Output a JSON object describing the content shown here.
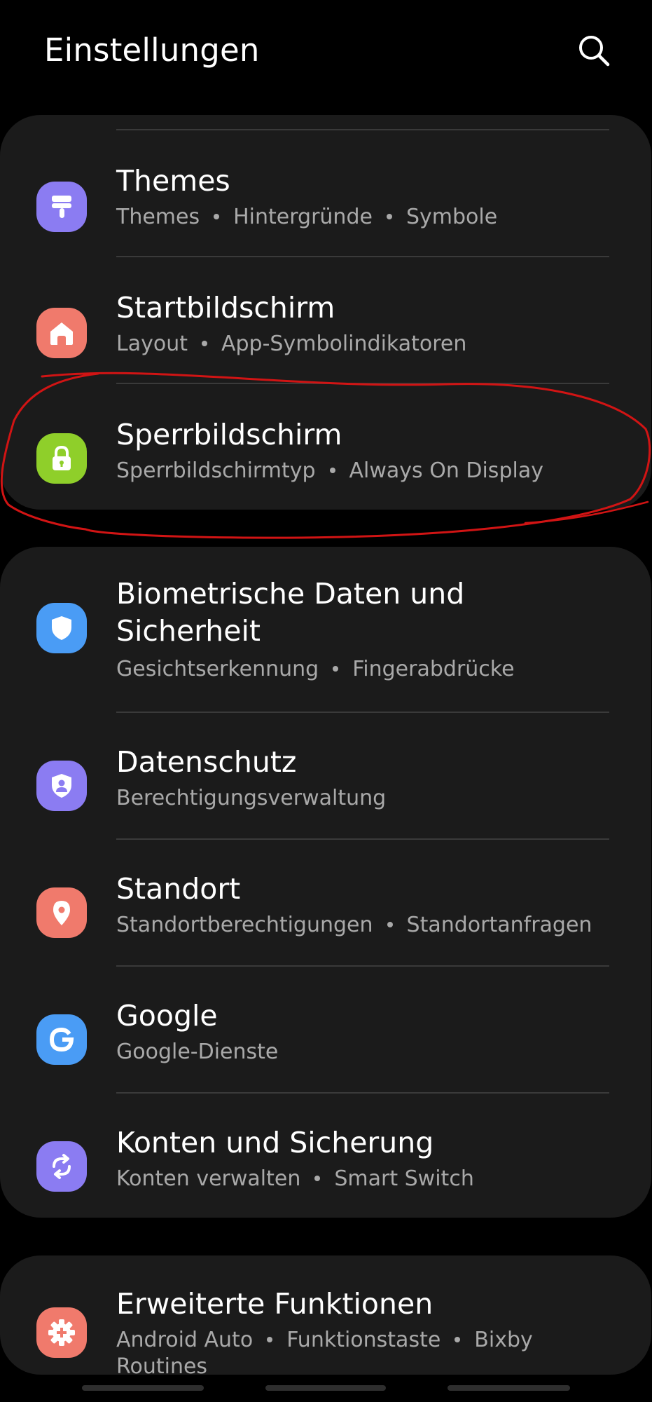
{
  "header": {
    "title": "Einstellungen",
    "search_icon": "search-icon"
  },
  "cards": [
    {
      "items": [
        {
          "title": "Themes",
          "subtitle": [
            "Themes",
            "Hintergründe",
            "Symbole"
          ],
          "icon": "paintbrush-icon",
          "icon_color": "#8b7cf2"
        },
        {
          "title": "Startbildschirm",
          "subtitle": [
            "Layout",
            "App-Symbolindikatoren"
          ],
          "icon": "home-icon",
          "icon_color": "#f07a6c"
        },
        {
          "title": "Sperrbildschirm",
          "subtitle": [
            "Sperrbildschirmtyp",
            "Always On Display"
          ],
          "icon": "lock-icon",
          "icon_color": "#8fcf2a"
        }
      ]
    },
    {
      "items": [
        {
          "title": "Biometrische Daten und Sicherheit",
          "subtitle": [
            "Gesichtserkennung",
            "Fingerabdrücke"
          ],
          "icon": "shield-icon",
          "icon_color": "#4a9cf5"
        },
        {
          "title": "Datenschutz",
          "subtitle": [
            "Berechtigungsverwaltung"
          ],
          "icon": "privacy-shield-icon",
          "icon_color": "#8b7cf2"
        },
        {
          "title": "Standort",
          "subtitle": [
            "Standortberechtigungen",
            "Standortanfragen"
          ],
          "icon": "location-pin-icon",
          "icon_color": "#f07a6c"
        },
        {
          "title": "Google",
          "subtitle": [
            "Google-Dienste"
          ],
          "icon": "google-icon",
          "icon_color": "#4a9cf5"
        },
        {
          "title": "Konten und Sicherung",
          "subtitle": [
            "Konten verwalten",
            "Smart Switch"
          ],
          "icon": "sync-icon",
          "icon_color": "#8b7cf2"
        }
      ]
    },
    {
      "items": [
        {
          "title": "Erweiterte Funktionen",
          "subtitle": [
            "Android Auto",
            "Funktionstaste",
            "Bixby Routines"
          ],
          "subtitle_line1": [
            "Android Auto",
            "Funktionstaste",
            "Bixby"
          ],
          "subtitle_line2": "Routines",
          "icon": "gear-plus-icon",
          "icon_color": "#f07a6c"
        }
      ]
    }
  ],
  "colors": {
    "background": "#000000",
    "card": "#1b1b1b",
    "divider": "#3a3a3a",
    "subtitle": "#a9a9a9",
    "annotation": "#d11414"
  }
}
